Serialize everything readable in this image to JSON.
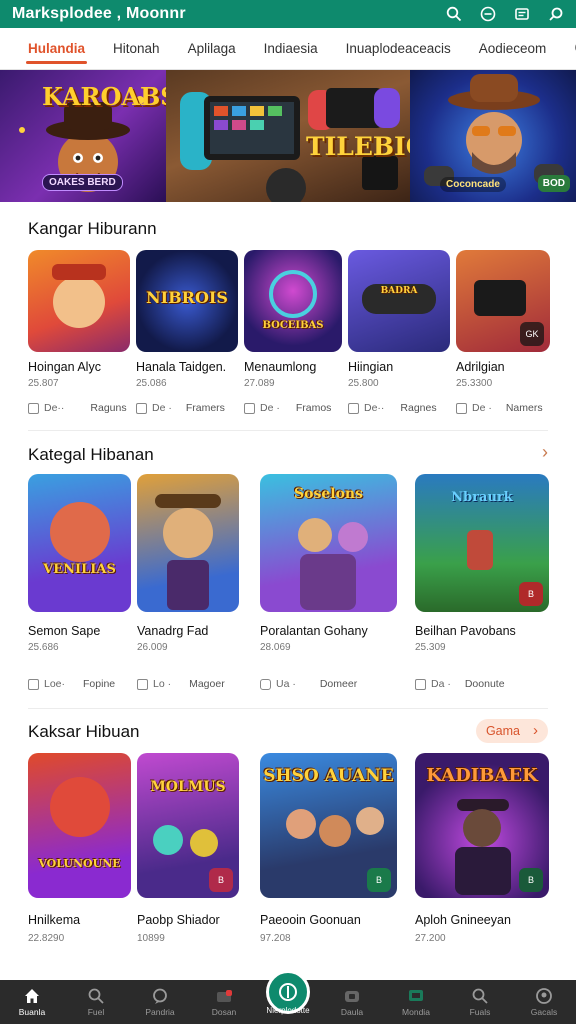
{
  "app": {
    "title": "Marksplodee ,  Moonnr",
    "accent": "#0e8a6d",
    "tab_accent": "#e0532b",
    "top_icons": [
      "search-icon",
      "emoji-icon",
      "news-icon",
      "search-alt-icon"
    ]
  },
  "tabs": [
    {
      "label": "Hulandia",
      "active": true
    },
    {
      "label": "Hitonah",
      "active": false
    },
    {
      "label": "Aplilaga",
      "active": false
    },
    {
      "label": "Indiaesia",
      "active": false
    },
    {
      "label": "Inuaplodeaceacis",
      "active": false
    },
    {
      "label": "Aodieceom",
      "active": false
    }
  ],
  "banner": {
    "panels": [
      {
        "title": "KAROABS",
        "subtitle": "OAKES  BERD"
      },
      {
        "title": "TILEBIGN"
      },
      {
        "subtitle": "Coconcade",
        "badge": "BOD"
      }
    ]
  },
  "sections": [
    {
      "heading": "Kangar Hiburann",
      "cards": [
        {
          "title": "Hoingan Alyc",
          "count": "25.807",
          "foot_left": "De··",
          "foot_right": "Raguns",
          "thumb_text": "",
          "badge": ""
        },
        {
          "title": "Hanala Taidgen.",
          "count": "25.086",
          "foot_left": "De ·",
          "foot_right": "Framers",
          "thumb_text": "NIBROIS",
          "badge": ""
        },
        {
          "title": "Menaumlong",
          "count": "27.089",
          "foot_left": "De ·",
          "foot_right": "Framos",
          "thumb_text": "BOCEIBAS",
          "badge": ""
        },
        {
          "title": "Hiingian",
          "count": "25.800",
          "foot_left": "De··",
          "foot_right": "Ragnes",
          "thumb_text": "BADRA",
          "badge": ""
        },
        {
          "title": "Adrilgian",
          "count": "25.3300",
          "foot_left": "De ·",
          "foot_right": "Namers",
          "thumb_text": "",
          "badge": "GK"
        }
      ]
    },
    {
      "heading": "Kategal Hibanan",
      "cards": [
        {
          "title": "Semon Sape",
          "count": "25.686",
          "foot_left": "Loe·",
          "foot_right": "Fopine",
          "thumb_text": "VENILIAS",
          "badge": ""
        },
        {
          "title": "Vanadrg Fad",
          "count": "26.009",
          "foot_left": "Lo ·",
          "foot_right": "Magoer",
          "thumb_text": "",
          "badge": ""
        },
        {
          "title": "Poralantan Gohany",
          "count": "28.069",
          "foot_left": "Ua ·",
          "foot_right": "Domeer",
          "thumb_text": "Soselons",
          "badge": ""
        },
        {
          "title": "Beilhan Pavobans",
          "count": "25.309",
          "foot_left": "Da ·",
          "foot_right": "Doonute",
          "thumb_text": "Nbraurk",
          "badge": "B"
        }
      ]
    },
    {
      "heading": "Kaksar Hibuan",
      "pill": "Gama",
      "cards": [
        {
          "title": "Hnilkema",
          "count": "22.8290",
          "thumb_text": "VOLUNOUNE",
          "badge": ""
        },
        {
          "title": "Paobp Shiador",
          "count": "10899",
          "thumb_text": "MOLMUS",
          "badge": "B"
        },
        {
          "title": "Paeooin Goonuan",
          "count": "97.208",
          "thumb_text": "SHSO AUANE",
          "badge": "B"
        },
        {
          "title": "Aploh Gnineeyan",
          "count": "27.200",
          "thumb_text": "KADIBAEK",
          "badge": "B"
        }
      ]
    }
  ],
  "bottom_nav": [
    {
      "label": "Buanla",
      "icon": "home-icon",
      "active": true
    },
    {
      "label": "Fuel",
      "icon": "search-icon",
      "active": false
    },
    {
      "label": "Pandria",
      "icon": "chat-icon",
      "active": false
    },
    {
      "label": "Dosan",
      "icon": "camera-icon",
      "active": false
    },
    {
      "label": "",
      "icon": "",
      "active": false
    },
    {
      "label": "Daula",
      "icon": "gamepad-icon",
      "active": false
    },
    {
      "label": "Mondia",
      "icon": "tv-icon",
      "active": false
    },
    {
      "label": "Fuals",
      "icon": "search-icon",
      "active": false
    },
    {
      "label": "Gacals",
      "icon": "profile-icon",
      "active": false
    }
  ],
  "nav_center": {
    "label": "Nierplodotte",
    "icon": "store-icon"
  }
}
